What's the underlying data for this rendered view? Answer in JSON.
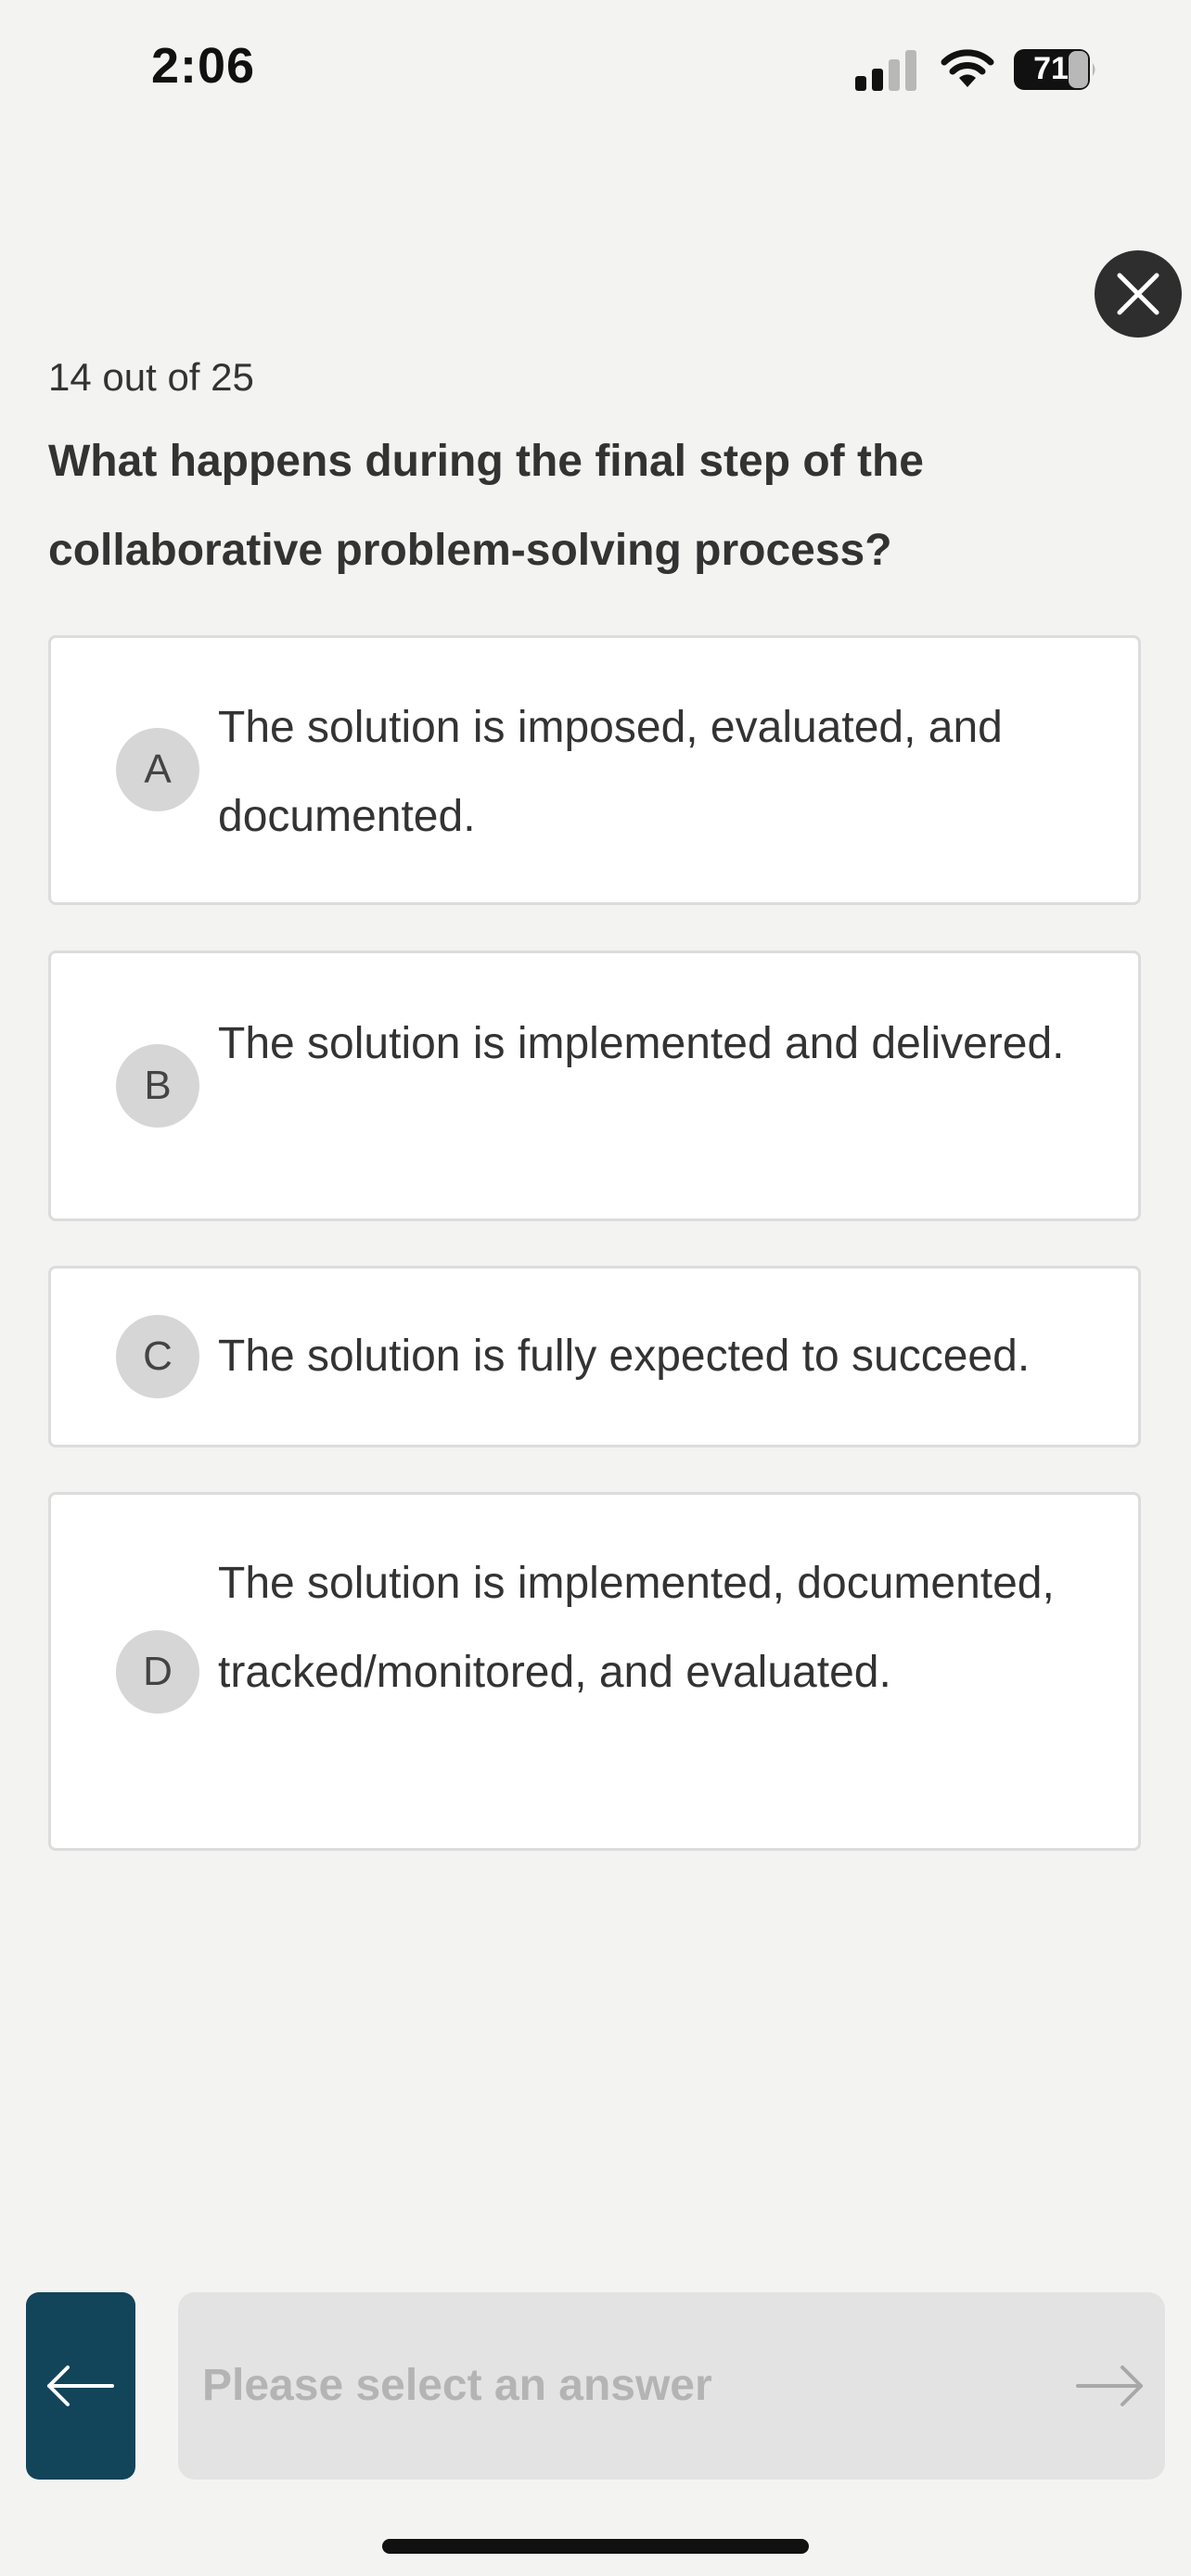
{
  "status_bar": {
    "time": "2:06",
    "battery_level": "71",
    "icons": [
      "signal-icon",
      "wifi-icon",
      "battery-icon"
    ]
  },
  "close_button": {
    "icon": "close-icon"
  },
  "quiz": {
    "progress": "14 out of 25",
    "question": "What happens during the final step of the collaborative problem-solving process?",
    "options": [
      {
        "letter": "A",
        "text": "The solution is imposed, evaluated, and documented."
      },
      {
        "letter": "B",
        "text": "The solution is implemented and delivered."
      },
      {
        "letter": "C",
        "text": "The solution is fully expected to succeed."
      },
      {
        "letter": "D",
        "text": "The solution is implemented, documented, tracked/monitored, and evaluated."
      }
    ]
  },
  "footer": {
    "back_icon": "arrow-left-icon",
    "submit_label": "Please select an answer",
    "next_icon": "arrow-right-icon"
  },
  "colors": {
    "background": "#f3f3f2",
    "back_button": "#12445a",
    "submit_disabled": "#e3e3e3",
    "badge": "#d6d6d6",
    "close_button": "#2e2e2e"
  }
}
